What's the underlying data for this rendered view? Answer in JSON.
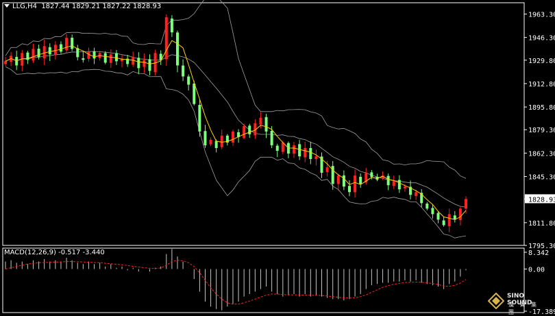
{
  "header": {
    "symbol": "LLG,H4",
    "ohlc": "1827.44 1829.21 1827.22 1828.93"
  },
  "macd_header": {
    "label": "MACD(12,26,9)",
    "values": "-0.517 -3.440"
  },
  "logo": {
    "name": "SINO SOUND",
    "sub": "漢 聲 集 團"
  },
  "colors": {
    "background": "#000000",
    "axis": "#ffffff",
    "bull_candle": "#ff2020",
    "bear_candle": "#7cff7c",
    "ma": "#ffd200",
    "bands": "#a0a0a0",
    "macd_hist": "#c8c8c8",
    "macd_signal": "#ff2020",
    "price_label_bg": "#ffffff"
  },
  "chart_data": [
    {
      "type": "candlestick",
      "title": "LLG,H4",
      "y_ticks": [
        "1963.30",
        "1946.30",
        "1929.80",
        "1912.80",
        "1895.80",
        "1879.30",
        "1862.30",
        "1845.30",
        "1828.93",
        "1811.80",
        "1795.30"
      ],
      "ylim": [
        1795.3,
        1971.5
      ],
      "current_price": 1828.93,
      "indicators": [
        "moving-average",
        "bollinger-bands"
      ],
      "price_path": [
        1929,
        1933,
        1926,
        1935,
        1930,
        1938,
        1932,
        1940,
        1934,
        1941,
        1936,
        1946,
        1938,
        1932,
        1930,
        1936,
        1931,
        1935,
        1928,
        1934,
        1929,
        1931,
        1927,
        1932,
        1924,
        1930,
        1922,
        1935,
        1930,
        1961,
        1950,
        1926,
        1918,
        1912,
        1898,
        1878,
        1868,
        1872,
        1866,
        1875,
        1870,
        1878,
        1874,
        1882,
        1876,
        1884,
        1888,
        1878,
        1868,
        1864,
        1870,
        1862,
        1868,
        1860,
        1866,
        1858,
        1860,
        1848,
        1852,
        1840,
        1846,
        1838,
        1834,
        1846,
        1840,
        1848,
        1845,
        1843,
        1846,
        1839,
        1842,
        1836,
        1838,
        1832,
        1834,
        1826,
        1822,
        1818,
        1814,
        1810,
        1818,
        1814,
        1822,
        1829
      ]
    },
    {
      "type": "macd",
      "title": "MACD(12,26,9)",
      "y_ticks": [
        "8.342",
        "0.00",
        "-17.389"
      ],
      "ylim": [
        -17.389,
        8.342
      ],
      "histogram": [
        3,
        3.5,
        2.5,
        3,
        2,
        3.5,
        3,
        4,
        3,
        3.5,
        3,
        4.5,
        3.5,
        2.5,
        2,
        3,
        2,
        2.5,
        1,
        2,
        0.5,
        1,
        -0.5,
        0.5,
        -1,
        0,
        -1,
        0.5,
        1,
        6,
        8,
        5,
        3,
        0,
        -4,
        -9,
        -13,
        -15,
        -16,
        -16.5,
        -15,
        -14,
        -13,
        -11,
        -10,
        -9,
        -8,
        -7,
        -9,
        -10,
        -11,
        -10.5,
        -10,
        -11,
        -10,
        -11,
        -10.5,
        -11,
        -11.5,
        -12,
        -12,
        -12.5,
        -12,
        -11,
        -10,
        -8,
        -6.5,
        -6,
        -5.5,
        -5.5,
        -5,
        -5,
        -4.5,
        -5,
        -4.5,
        -5.5,
        -6,
        -6.5,
        -7,
        -8,
        -6,
        -5,
        -3,
        -0.5
      ],
      "signal": [
        0,
        0.5,
        1,
        1.5,
        2,
        2.3,
        2.5,
        2.6,
        2.7,
        2.8,
        2.8,
        3,
        3,
        2.9,
        2.8,
        2.7,
        2.6,
        2.5,
        2.3,
        2.1,
        1.9,
        1.7,
        1.4,
        1.1,
        0.8,
        0.5,
        0.3,
        0.2,
        0.4,
        1.5,
        3,
        3.5,
        3.3,
        2.5,
        1,
        -1.5,
        -4.5,
        -7.5,
        -10,
        -12,
        -13.5,
        -14,
        -14,
        -13.5,
        -12.8,
        -12,
        -11.2,
        -10.4,
        -10,
        -10,
        -10.2,
        -10.3,
        -10.3,
        -10.4,
        -10.4,
        -10.5,
        -10.5,
        -10.6,
        -10.8,
        -11,
        -11.3,
        -11.5,
        -11.6,
        -11.5,
        -11,
        -10.3,
        -9.3,
        -8.3,
        -7.3,
        -6.6,
        -6.1,
        -5.7,
        -5.4,
        -5.3,
        -5.2,
        -5.3,
        -5.5,
        -5.8,
        -6.2,
        -6.8,
        -6.9,
        -6.5,
        -5.6,
        -4.2
      ]
    }
  ]
}
